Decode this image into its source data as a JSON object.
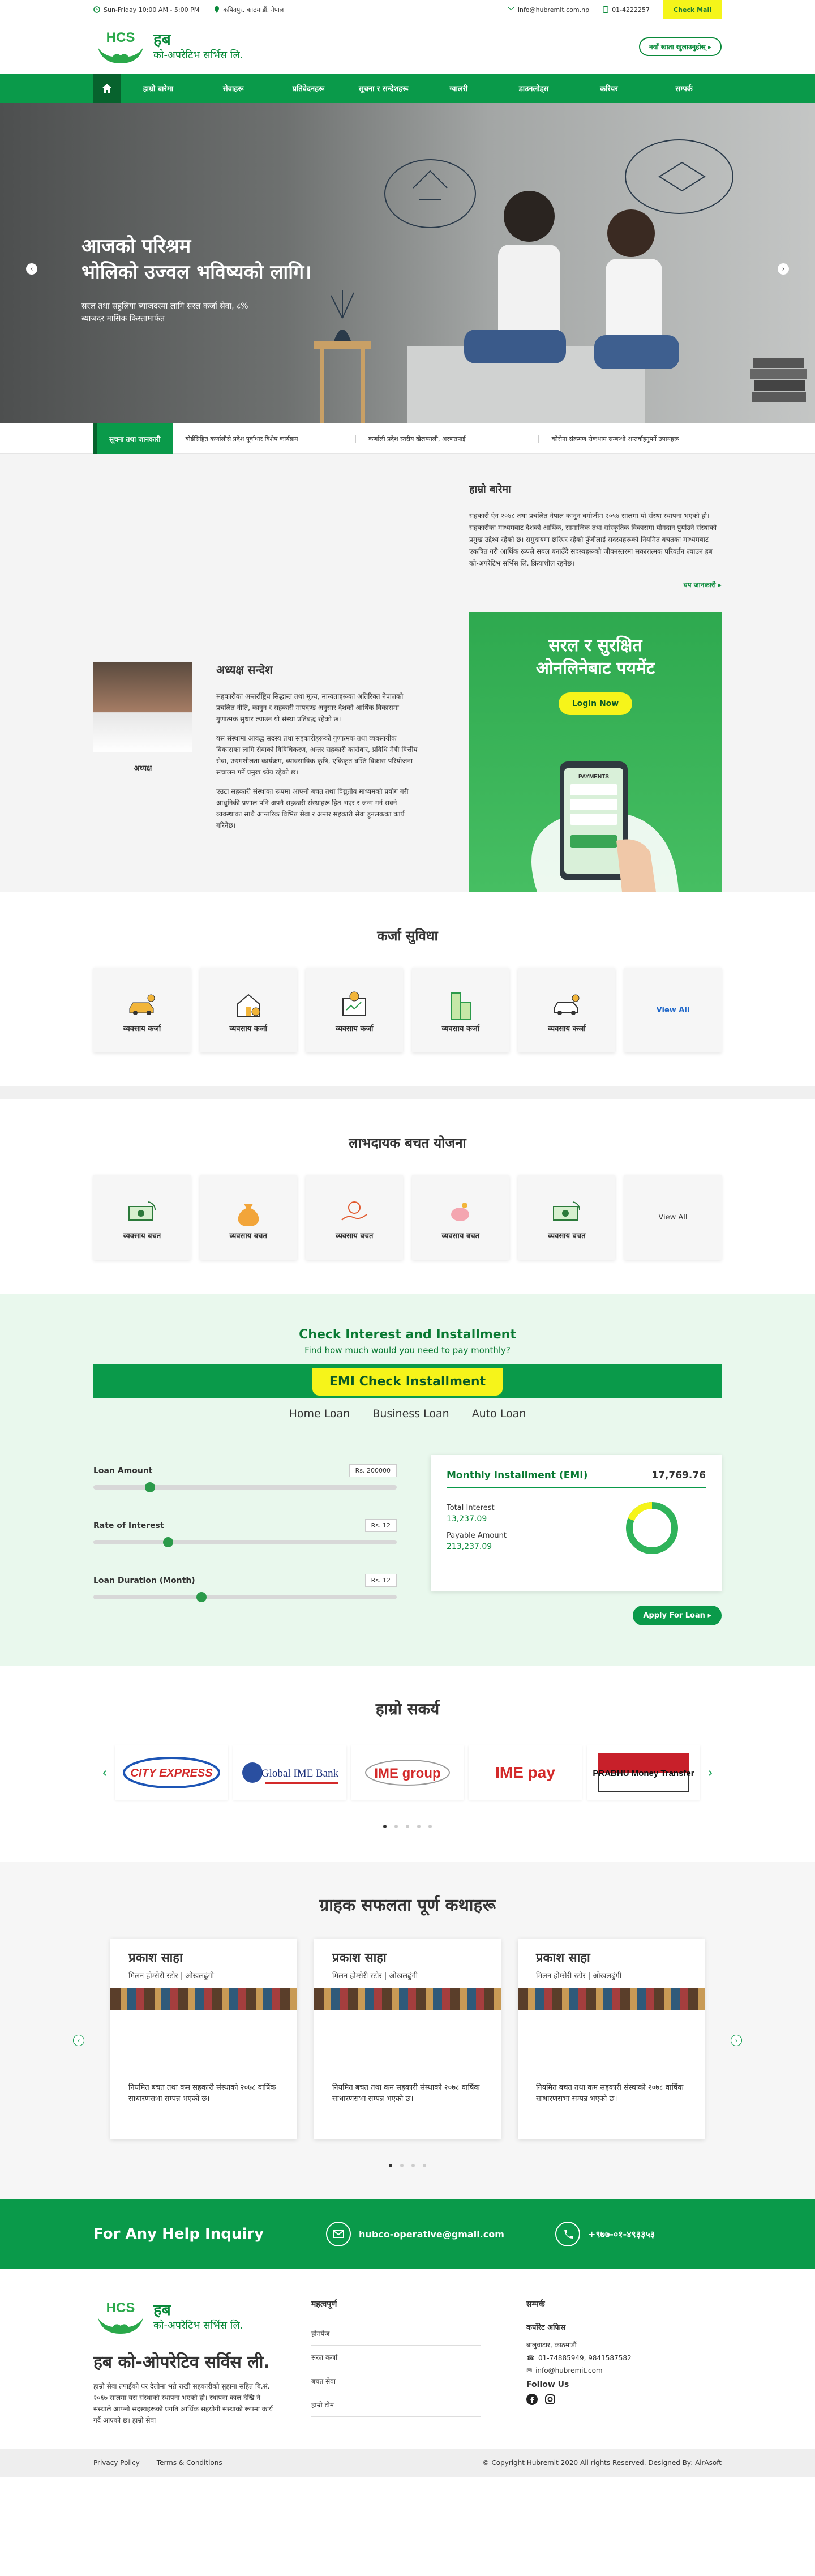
{
  "topbar": {
    "hours": "Sun-Friday 10:00 AM - 5:00 PM",
    "address": "कपितपुर, काठमाडौं, नेपाल",
    "email": "info@hubremit.com.np",
    "phone": "01-4222257",
    "checkmail": "Check Mail"
  },
  "header": {
    "logo_initials": "HCS",
    "logo_name": "हब",
    "logo_sub": "को-अपरेटिभ सर्भिस लि.",
    "cta": "नयाँ खाता खुलाउनुहोस् ▸"
  },
  "nav": [
    "हाम्रो बारेमा",
    "सेवाहरू",
    "प्रतिवेदनहरू",
    "सूचना र सन्देशहरू",
    "ग्यालरी",
    "डाउनलोड्स",
    "करियर",
    "सम्पर्क"
  ],
  "hero": {
    "line1": "आजको परिश्रम",
    "line2": "भोलिको उज्वल भविष्यको लागि।",
    "desc": "सरल तथा सहुलिया ब्याजदरमा लागि सरल कर्जा सेवा, ८% ब्याजदर मासिक किस्तामार्फत"
  },
  "ticker": {
    "label": "सूचना तथा जानकारी",
    "items": [
      "बोर्डसिहित कर्णालीसे प्रदेश पूर्वाधार विशेष कार्यक्रम",
      "कर्णाली प्रदेश स्तरीय खेलग्याली, अरणतपाई",
      "कोरोना संक्रमण रोकथाम सम्बन्धी अन्तर्वाहनुपर्ने उपायहरू"
    ]
  },
  "about": {
    "title": "हाम्रो बारेमा",
    "text": "सहकारी ऐन २०४८ तथा प्रचलित नेपाल कानुन बमोजीम २०५४ सालमा यो संस्था स्थापना भएको हो। सहकारीका माध्यमबाट देशको आर्थिक, सामाजिक तथा सांस्कृतिक विकासमा योगदान पुर्याउने संस्थाको प्रमुख उद्देश्य रहेको छ। समुदायमा छरिएर रहेको पुँजीलाई सदस्यहरूको नियमित बचतका माध्यमबाट एकत्रित गरी आर्थिक रूपले सबल बनाउँदै सदस्यहरूको जीवनस्तरमा सकारात्मक परिवर्तन ल्याउन हब को-अपरेटिभ सर्भिस लि. क्रियाशील रहनेछ।",
    "more": "थप जानकारी ▸"
  },
  "ceo": {
    "title": "अध्यक्ष सन्देश",
    "caption": "अध्यक्ष",
    "p1": "सहकारीका अन्तर्राष्ट्रिय सिद्धान्त तथा मूल्य, मान्यताहरूका अतिरिक्त नेपालको प्रचलित नीति, कानुन र सहकारी मापदण्ड अनुसार देशको आर्थिक विकासमा गुणात्मक सुधार ल्याउन यो संस्था प्रतिबद्ध रहेको छ।",
    "p2": "यस संस्थामा आवद्ध सदस्य तथा सहकारीहरूको गुणात्मक तथा व्यवसायीक विकासका लागि सेवाको विविधिकरण, अन्तर सहकारी कारोबार, प्रविधि मैत्री वित्तीय सेवा, उद्यमशीलता कार्यक्रम, व्यावसायिक कृषि, एकिकृत बस्ति विकास परियोजना संचालन गर्ने प्रमुख ध्येय रहेको छ।",
    "p3": "एउटा सहकारी संस्थाका रूपमा आफ्नो बचत तथा विद्युतीय माध्यमको प्रयोग गरी आधुनिकी प्रणाल पनि अपनै सहकारी संस्थाहरू हित भएर र जन्म गर्न सक्ने व्यवस्थाका साथै आन्तरिक विभिन्न सेवा र अन्तर सहकारी सेवा हुनलकका कार्य गरिनेछ।"
  },
  "payment": {
    "title1": "सरल र सुरक्षित",
    "title2": "ओनलिनेबाट पयमेंट",
    "btn": "Login Now",
    "screen": "PAYMENTS"
  },
  "loans": {
    "title": "कर्जा सुविधा",
    "items": [
      "व्यवसाय कर्जा",
      "व्यवसाय कर्जा",
      "व्यवसाय कर्जा",
      "व्यवसाय कर्जा",
      "व्यवसाय कर्जा"
    ],
    "view_all": "View All"
  },
  "savings": {
    "title": "लाभदायक बचत योजना",
    "items": [
      "व्यवसाय बचत",
      "व्यवसाय बचत",
      "व्यवसाय बचत",
      "व्यवसाय बचत",
      "व्यवसाय बचत"
    ],
    "view_all": "View All"
  },
  "emi": {
    "title": "Check Interest and Installment",
    "subtitle": "Find how much would you need to pay monthly?",
    "bar": "EMI Check Installment",
    "tabs": [
      "Home Loan",
      "Business Loan",
      "Auto Loan"
    ],
    "amount_label": "Loan Amount",
    "amount_value": "Rs. 200000",
    "amount_pos": 0.17,
    "rate_label": "Rate of Interest",
    "rate_value": "Rs. 12",
    "rate_pos": 0.23,
    "dur_label": "Loan Duration (Month)",
    "dur_value": "Rs. 12",
    "dur_pos": 0.34,
    "result_title": "Monthly Installment (EMI)",
    "result_value": "17,769.76",
    "ti_label": "Total Interest",
    "ti_value": "13,237.09",
    "pa_label": "Payable Amount",
    "pa_value": "213,237.09",
    "apply": "Apply For Loan ▸"
  },
  "partners": {
    "title": "हाम्रो सकर्य",
    "logos": [
      "CITY EXPRESS",
      "Global IME Bank",
      "IME group",
      "IME pay",
      "PRABHU Money Transfer"
    ]
  },
  "testimonials": {
    "title": "ग्राहक सफलता पूर्ण कथाहरू",
    "items": [
      {
        "name": "प्रकाश साहा",
        "org": "मिलन होम्सेरी स्टोर | ओखलढुंगी",
        "quote": "नियमित बचत तथा कम सहकारी संस्थाको २०७८ वार्षिक साधारणसभा सम्पन्न भएको छ।"
      },
      {
        "name": "प्रकाश साहा",
        "org": "मिलन होम्सेरी स्टोर | ओखलढुंगी",
        "quote": "नियमित बचत तथा कम सहकारी संस्थाको २०७८ वार्षिक साधारणसभा सम्पन्न भएको छ।"
      },
      {
        "name": "प्रकाश साहा",
        "org": "मिलन होम्सेरी स्टोर | ओखलढुंगी",
        "quote": "नियमित बचत तथा कम सहकारी संस्थाको २०७८ वार्षिक साधारणसभा सम्पन्न भएको छ।"
      }
    ]
  },
  "help": {
    "title": "For Any Help Inquiry",
    "email": "hubco-operative@gmail.com",
    "phone": "+९७७-०१-४९३३५३"
  },
  "footer": {
    "org_name": "हब को-ओपरेटिव सर्विस ली.",
    "about": "हाम्रो सेवा तपाईंको घर दैलोमा भन्ने राखी सहकारीको सुहाना सहित बि.सं. २०६७ सालमा यस संस्थाको स्थापना भएको हो। स्थापना काल देखि नै संस्थाले आफ्नो सदस्यहरूको प्रगति आर्थिक सहयोगी संस्थाको रूपमा कार्य गर्दै आएको छ। हाम्रो सेवा",
    "links_title": "महत्वपूर्ण",
    "links": [
      "होमपेज",
      "सरल कर्जा",
      "बचत सेवा",
      "हाम्रो टीम"
    ],
    "contact_title": "सम्पर्क",
    "office": "कर्पोरेट अफिस",
    "addr": "बालुवाटार, काठमाडौं",
    "phones": "01-74885949, 9841587582",
    "mail": "info@hubremit.com",
    "follow": "Follow Us"
  },
  "bottom": {
    "privacy": "Privacy Policy",
    "terms": "Terms & Conditions",
    "copy": "© Copyright Hubremit 2020 All rights Reserved. Designed By: AirAsoft"
  },
  "colors": {
    "brand": "#0a9a4a",
    "accent": "#f6f41a"
  }
}
